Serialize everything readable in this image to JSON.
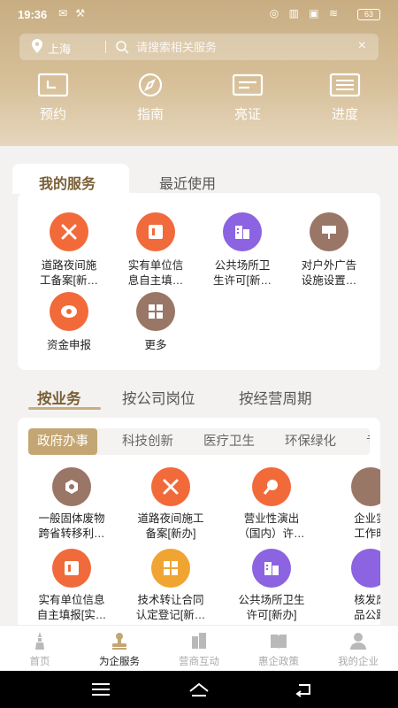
{
  "status": {
    "time": "19:36",
    "left_icons": "✉ ⚒",
    "right_icons": "◎ ▥ ▣ ≋",
    "battery": "63"
  },
  "search": {
    "city": "上海",
    "placeholder": "请搜索相关服务",
    "clear": "×"
  },
  "quick_actions": [
    {
      "label": "预约",
      "icon": "calendar-icon"
    },
    {
      "label": "指南",
      "icon": "compass-icon"
    },
    {
      "label": "亮证",
      "icon": "id-card-icon"
    },
    {
      "label": "进度",
      "icon": "progress-list-icon"
    }
  ],
  "my_services": {
    "tabs": [
      "我的服务",
      "最近使用"
    ],
    "active_tab": "我的服务",
    "items": [
      {
        "label": "道路夜间施\n工备案[新…",
        "icon": "tools-icon",
        "color": "#f26a3a"
      },
      {
        "label": "实有单位信\n息自主填…",
        "icon": "form-icon",
        "color": "#f06a3c"
      },
      {
        "label": "公共场所卫\n生许可[新…",
        "icon": "building-icon",
        "color": "#8c63e0"
      },
      {
        "label": "对户外广告\n设施设置…",
        "icon": "billboard-icon",
        "color": "#9a7666"
      },
      {
        "label": "资金申报",
        "icon": "money-icon",
        "color": "#f26a3a"
      },
      {
        "label": "更多",
        "icon": "grid-more-icon",
        "color": "#9a7666"
      }
    ]
  },
  "category_tabs": [
    "按业务",
    "按公司岗位",
    "按经营周期"
  ],
  "business_pills": [
    "政府办事",
    "科技创新",
    "医疗卫生",
    "环保绿化",
    "专"
  ],
  "business_items": [
    {
      "label": "一般固体废物\n跨省转移利…",
      "icon": "recycle-icon",
      "color": "#9a7666"
    },
    {
      "label": "道路夜间施工\n备案[新办]",
      "icon": "tools-icon",
      "color": "#f26a3a"
    },
    {
      "label": "营业性演出\n（国内）许…",
      "icon": "performance-icon",
      "color": "#f26a3a"
    },
    {
      "label": "企业实\n工作时",
      "icon": "partial-icon",
      "color": "#9a7666"
    },
    {
      "label": "实有单位信息\n自主填报[实…",
      "icon": "form-icon",
      "color": "#f06a3c"
    },
    {
      "label": "技术转让合同\n认定登记[新…",
      "icon": "grid-more-icon",
      "color": "#f0a532"
    },
    {
      "label": "公共场所卫生\n许可[新办]",
      "icon": "building-icon",
      "color": "#8c63e0"
    },
    {
      "label": "核发废\n品公路",
      "icon": "partial-icon",
      "color": "#8c63e0"
    }
  ],
  "tabbar": [
    {
      "label": "首页",
      "icon": "tower-icon"
    },
    {
      "label": "为企服务",
      "icon": "stamp-icon"
    },
    {
      "label": "营商互动",
      "icon": "chat-building-icon"
    },
    {
      "label": "惠企政策",
      "icon": "policy-book-icon"
    },
    {
      "label": "我的企业",
      "icon": "user-icon"
    }
  ],
  "tabbar_active": "为企服务"
}
